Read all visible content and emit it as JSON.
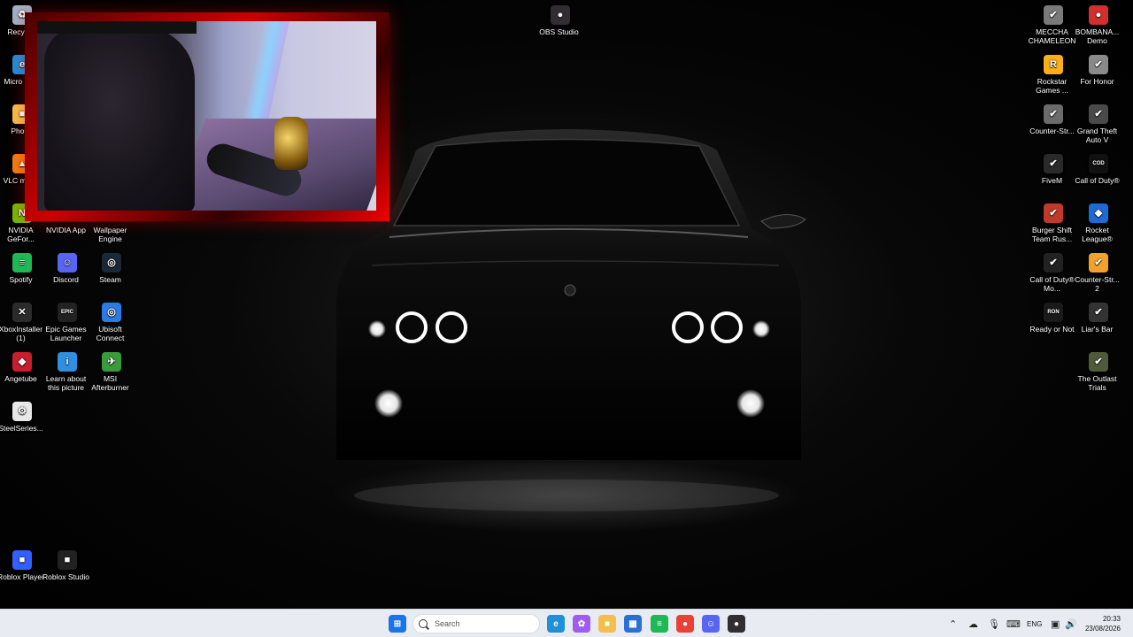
{
  "desktop": {
    "left_column_1": [
      {
        "label": "Recycle",
        "icon": "recycle-bin-icon",
        "color": "#9db3c8",
        "glyph": "♻"
      },
      {
        "label": "Micro Edg",
        "icon": "edge-icon",
        "color": "#1f8fd8",
        "glyph": "e"
      },
      {
        "label": "Photo",
        "icon": "folder-icon",
        "color": "#f2c04a",
        "glyph": "■"
      },
      {
        "label": "VLC m pla",
        "icon": "vlc-icon",
        "color": "#f07d12",
        "glyph": "▲"
      },
      {
        "label": "NVIDIA GeFor...",
        "icon": "nvidia-geforce-icon",
        "color": "#76b900",
        "glyph": "N"
      },
      {
        "label": "Spotify",
        "icon": "spotify-icon",
        "color": "#1db954",
        "glyph": "≡"
      },
      {
        "label": "XboxInstaller (1)",
        "icon": "xbox-icon",
        "color": "#2b2b2b",
        "glyph": "✕"
      },
      {
        "label": "Angetube",
        "icon": "angetube-icon",
        "color": "#c81e2d",
        "glyph": "◆"
      },
      {
        "label": "SteelSeries...",
        "icon": "steelseries-icon",
        "color": "#e8e8e8",
        "glyph": "⚙"
      }
    ],
    "left_column_2": [
      {
        "label": "NVIDIA App",
        "icon": "nvidia-app-icon",
        "color": "#000000",
        "glyph": ""
      },
      {
        "label": "Discord",
        "icon": "discord-icon",
        "color": "#5865f2",
        "glyph": "☺"
      },
      {
        "label": "Epic Games Launcher",
        "icon": "epic-games-icon",
        "color": "#222222",
        "glyph": "EPIC"
      },
      {
        "label": "Learn about this picture",
        "icon": "learn-picture-icon",
        "color": "#2f8fe0",
        "glyph": "i"
      }
    ],
    "left_column_3": [
      {
        "label": "Wallpaper Engine",
        "icon": "wallpaper-engine-icon",
        "color": "#000000",
        "glyph": ""
      },
      {
        "label": "Steam",
        "icon": "steam-icon",
        "color": "#1b2838",
        "glyph": "◎"
      },
      {
        "label": "Ubisoft Connect",
        "icon": "ubisoft-icon",
        "color": "#2c7be5",
        "glyph": "◎"
      },
      {
        "label": "MSI Afterburner",
        "icon": "msi-afterburner-icon",
        "color": "#3a9b3a",
        "glyph": "✈"
      }
    ],
    "bottom_left": [
      {
        "label": "Roblox Player",
        "icon": "roblox-player-icon",
        "color": "#335fff",
        "glyph": "■"
      },
      {
        "label": "Roblox Studio",
        "icon": "roblox-studio-icon",
        "color": "#222222",
        "glyph": "■"
      }
    ],
    "top_center": {
      "label": "OBS Studio",
      "icon": "obs-studio-icon",
      "color": "#302e31",
      "glyph": "●"
    },
    "right_column_1": [
      {
        "label": "MECCHA CHAMELEON",
        "icon": "meccha-chameleon-icon",
        "color": "#7a7a7a",
        "glyph": "✔"
      },
      {
        "label": "Rockstar Games ...",
        "icon": "rockstar-games-icon",
        "color": "#fcaf17",
        "glyph": "R"
      },
      {
        "label": "Counter-Str...",
        "icon": "counter-strike-icon",
        "color": "#6b6b6b",
        "glyph": "✔"
      },
      {
        "label": "FiveM",
        "icon": "fivem-icon",
        "color": "#2a2a2a",
        "glyph": "✔"
      },
      {
        "label": "Burger Shift Team Rus...",
        "icon": "burger-shift-icon",
        "color": "#c0392b",
        "glyph": "✔"
      },
      {
        "label": "Call of Duty® Mo...",
        "icon": "call-of-duty-mw-icon",
        "color": "#222222",
        "glyph": "✔"
      },
      {
        "label": "Ready or Not",
        "icon": "ready-or-not-icon",
        "color": "#1a1a1a",
        "glyph": "RON"
      }
    ],
    "right_column_2": [
      {
        "label": "BOMBANA... Demo",
        "icon": "bombana-demo-icon",
        "color": "#d32f2f",
        "glyph": "●"
      },
      {
        "label": "For Honor",
        "icon": "for-honor-icon",
        "color": "#8a8a8a",
        "glyph": "✔"
      },
      {
        "label": "Grand Theft Auto V",
        "icon": "gta-v-icon",
        "color": "#4a4a4a",
        "glyph": "✔"
      },
      {
        "label": "Call of Duty®",
        "icon": "call-of-duty-icon",
        "color": "#111111",
        "glyph": "COD"
      },
      {
        "label": "Rocket League®",
        "icon": "rocket-league-icon",
        "color": "#1e6bd6",
        "glyph": "◆"
      },
      {
        "label": "Counter-Str... 2",
        "icon": "counter-strike-2-icon",
        "color": "#f4a12b",
        "glyph": "✔"
      },
      {
        "label": "Liar's Bar",
        "icon": "liars-bar-icon",
        "color": "#333333",
        "glyph": "✔"
      },
      {
        "label": "The Outlast Trials",
        "icon": "outlast-trials-icon",
        "color": "#4f5a3b",
        "glyph": "✔"
      }
    ]
  },
  "webcam_overlay": {
    "name": "webcam-overlay"
  },
  "taskbar": {
    "search_placeholder": "Search",
    "pinned": [
      {
        "name": "start-icon",
        "color": "#1a73e8",
        "glyph": "⊞"
      },
      {
        "name": "edge-icon",
        "color": "#1f8fd8",
        "glyph": "e"
      },
      {
        "name": "copilot-icon",
        "color": "#a05cf0",
        "glyph": "✿"
      },
      {
        "name": "file-explorer-icon",
        "color": "#f2c04a",
        "glyph": "■"
      },
      {
        "name": "microsoft-store-icon",
        "color": "#2b6fd6",
        "glyph": "▦"
      },
      {
        "name": "spotify-icon",
        "color": "#1db954",
        "glyph": "≡"
      },
      {
        "name": "chrome-icon",
        "color": "#e94235",
        "glyph": "●"
      },
      {
        "name": "discord-icon",
        "color": "#5865f2",
        "glyph": "☺"
      },
      {
        "name": "obs-studio-icon",
        "color": "#302e31",
        "glyph": "●"
      }
    ],
    "tray": {
      "language": "ENG",
      "time": "20:33",
      "date": "23/08/2026"
    }
  }
}
